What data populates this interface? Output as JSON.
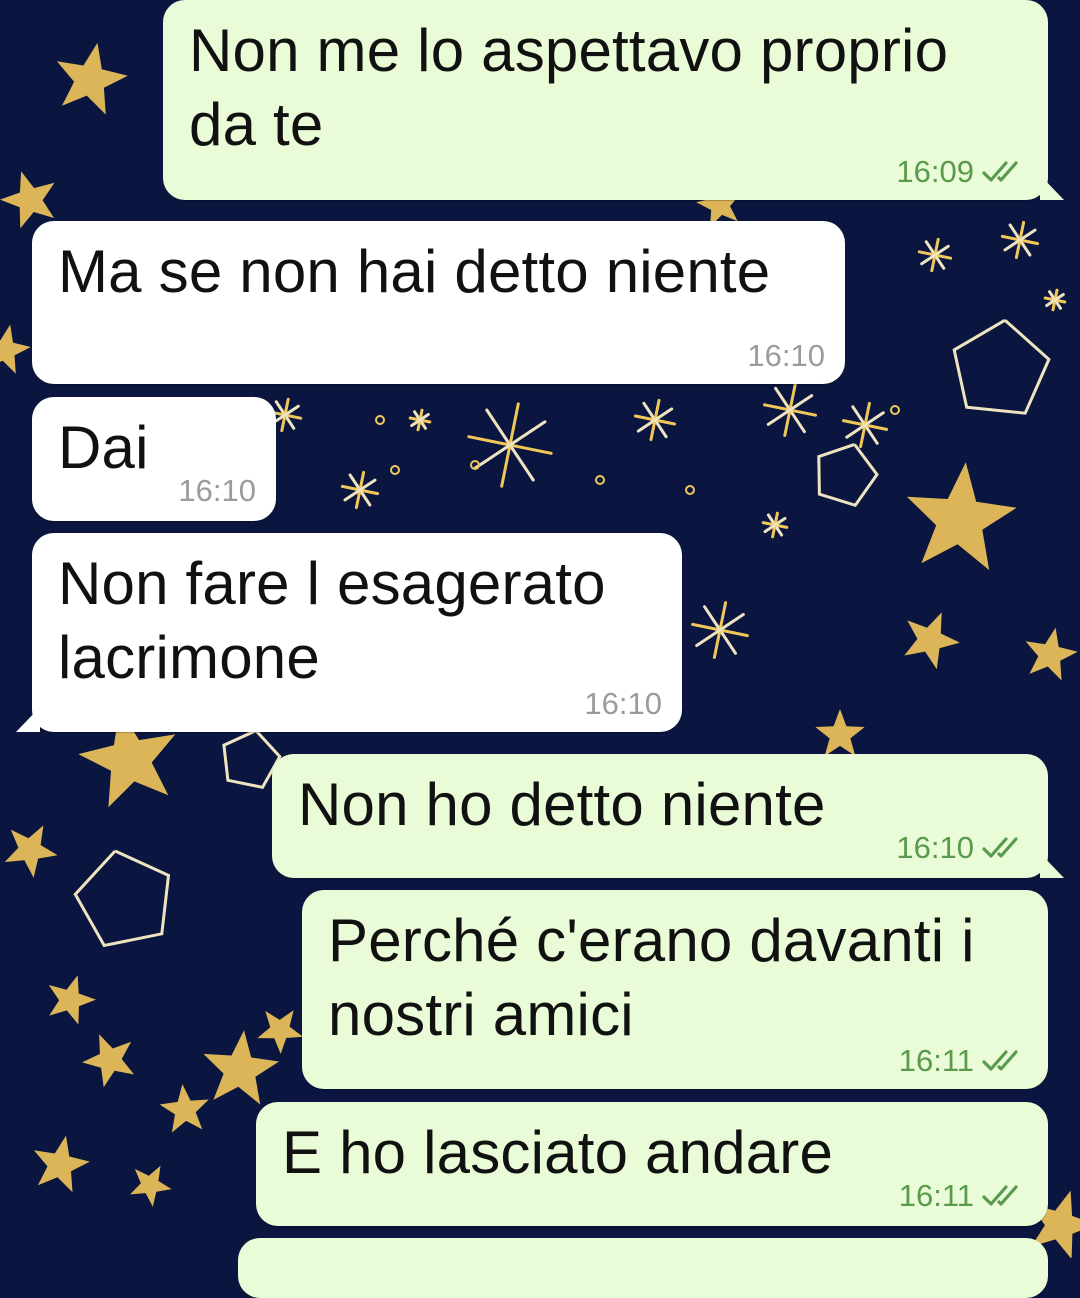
{
  "theme": {
    "wallpaper": "#0b1640",
    "star_color": "#f2c75a",
    "outgoing_bubble": "#e9fcd7",
    "incoming_bubble": "#ffffff",
    "tick_color": "#5a9a4c"
  },
  "messages": [
    {
      "direction": "outgoing",
      "text_lines": [
        "Non me lo aspettavo proprio",
        "da te"
      ],
      "time": "16:09",
      "status": "read-double-tick-icon"
    },
    {
      "direction": "incoming",
      "text_lines": [
        "Ma se non hai detto niente"
      ],
      "time": "16:10"
    },
    {
      "direction": "incoming",
      "text_lines": [
        "Dai"
      ],
      "time": "16:10"
    },
    {
      "direction": "incoming",
      "text_lines": [
        "Non fare l esagerato",
        "lacrimone"
      ],
      "time": "16:10"
    },
    {
      "direction": "outgoing",
      "text_lines": [
        "Non ho detto niente"
      ],
      "time": "16:10",
      "status": "read-double-tick-icon"
    },
    {
      "direction": "outgoing",
      "text_lines": [
        "Perché c'erano davanti i",
        "nostri amici"
      ],
      "time": "16:11",
      "status": "read-double-tick-icon"
    },
    {
      "direction": "outgoing",
      "text_lines": [
        "E ho lasciato andare"
      ],
      "time": "16:11",
      "status": "read-double-tick-icon"
    }
  ]
}
